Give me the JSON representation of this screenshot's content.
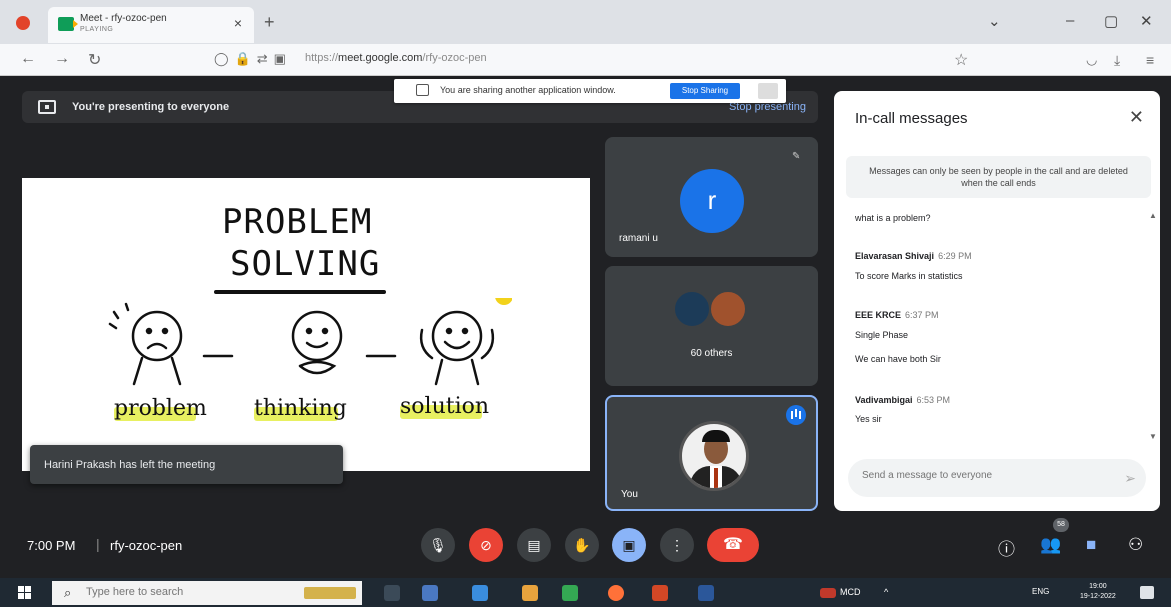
{
  "browser": {
    "tab_title": "Meet - rfy-ozoc-pen",
    "tab_subtitle": "PLAYING",
    "tab_close": "×",
    "new_tab": "+",
    "url_host": "https://meet.google.com/",
    "url_path": "rfy-ozoc-pen",
    "url_host_bold": "meet.google.com",
    "url_prefix": "https://",
    "window_controls": [
      "⌄",
      "–",
      "▢",
      "✕"
    ]
  },
  "share_popup": {
    "text": "You are sharing another application window.",
    "stop_label": "Stop Sharing"
  },
  "presenting_bar": {
    "text": "You're presenting to everyone",
    "stop_label": "Stop presenting"
  },
  "slide": {
    "title_line1": "PROBLEM",
    "title_line2": "SOLVING",
    "labels": [
      "problem",
      "thinking",
      "solution"
    ]
  },
  "toast": {
    "text": "Harini Prakash has left the meeting"
  },
  "tiles": {
    "ramani_initial": "r",
    "ramani_name": "ramani u",
    "others_label": "60 others",
    "you_label": "You"
  },
  "chat": {
    "title": "In-call messages",
    "close": "✕",
    "notice": "Messages can only be seen by people in the call and are deleted when the call ends",
    "messages": [
      {
        "text": "what is a problem?"
      },
      {
        "sender": "Elavarasan Shivaji",
        "time": "6:29 PM",
        "text": "To score Marks in statistics"
      },
      {
        "sender": "EEE KRCE",
        "time": "6:37 PM",
        "text": "Single Phase"
      },
      {
        "text": "We can have both Sir"
      },
      {
        "sender": "Vadivambigai",
        "time": "6:53 PM",
        "text": "Yes sir"
      }
    ],
    "input_placeholder": "Send a message to everyone"
  },
  "meeting_bar": {
    "time": "7:00 PM",
    "separator": "|",
    "code": "rfy-ozoc-pen",
    "people_badge": "58"
  },
  "taskbar": {
    "search_placeholder": "Type here to search",
    "tray_label": "MCD",
    "lang": "ENG",
    "time": "19:00",
    "date": "19-12-2022"
  },
  "colors": {
    "meet_bg": "#202124",
    "tile_bg": "#3c4043",
    "accent_blue": "#1a73e8",
    "end_call_red": "#ea4335",
    "highlight_yellow": "#e8f061"
  }
}
